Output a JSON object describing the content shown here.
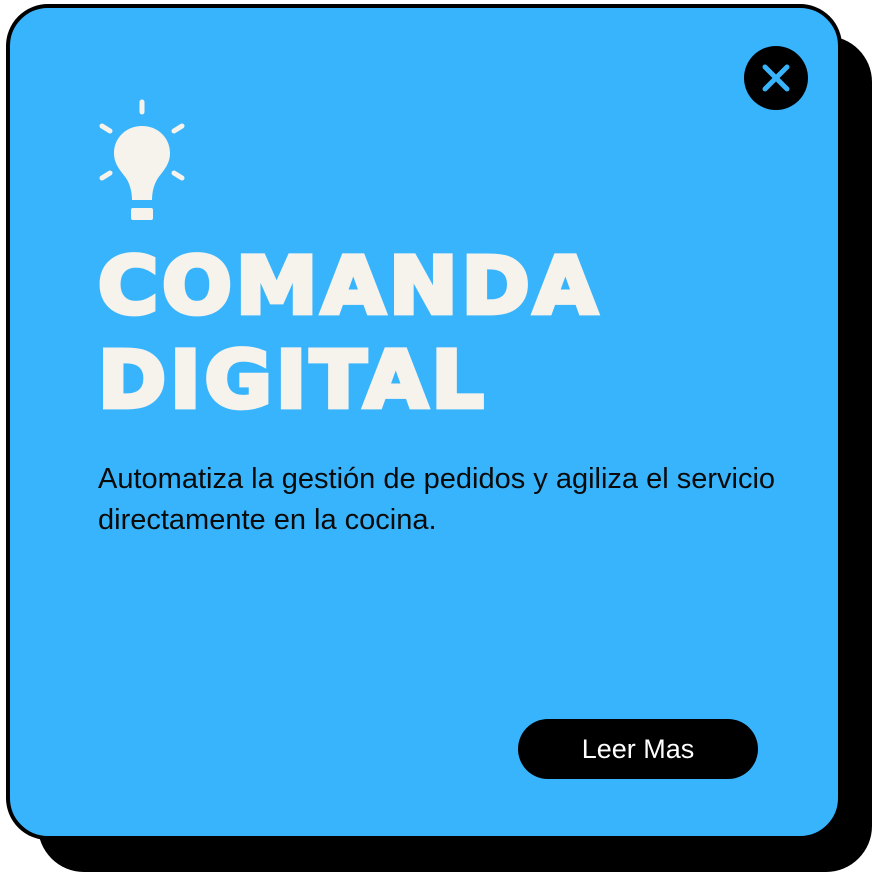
{
  "card": {
    "title_line1": "COMANDA",
    "title_line2": "DIGITAL",
    "description": "Automatiza la gestión de pedidos y agiliza el servicio directamente en la cocina.",
    "read_more_label": "Leer Mas"
  },
  "icons": {
    "close": "close-icon",
    "idea": "lightbulb-icon"
  },
  "colors": {
    "card_background": "#38b4fd",
    "card_border": "#000000",
    "title_text": "#f6f2ec",
    "body_text": "#0a0a0a",
    "button_background": "#000000",
    "button_text": "#ffffff",
    "close_x": "#38b4fd"
  }
}
